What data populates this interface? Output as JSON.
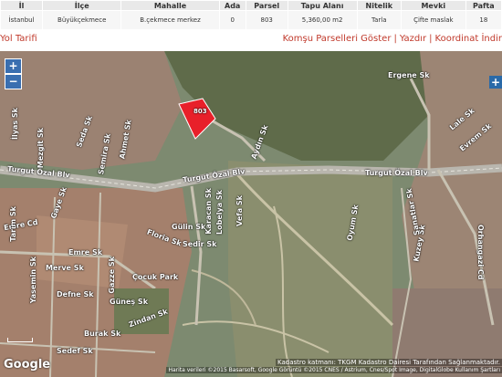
{
  "table": {
    "headers": [
      "İl",
      "İlçe",
      "Mahalle",
      "Ada",
      "Parsel",
      "Tapu Alanı",
      "Nitelik",
      "Mevki",
      "Pafta"
    ],
    "row": [
      "İstanbul",
      "Büyükçekmece",
      "B.çekmece merkez",
      "0",
      "803",
      "5,360,00 m2",
      "Tarla",
      "Çifte maslak",
      "18"
    ]
  },
  "links": {
    "route": "Yol Tarifi",
    "neighbors": "Komşu Parselleri Göster",
    "print": "Yazdır",
    "coords": "Koordinat İndir",
    "separator": "|"
  },
  "map": {
    "zoom_in": "+",
    "zoom_out": "−",
    "parcel_label": "803",
    "plus_marker": "+",
    "google": "Google",
    "kadastro": "Kadastro katmanı: TKGM Kadastro Dairesi Tarafından Sağlanmaktadır.",
    "attribution": "Harita verileri ©2015 Basarsoft, Google Görüntü ©2015 CNES / Astrium, Cnes/Spot Image, DigitalGlobe   Kullanım Şartları",
    "streets": {
      "turgut1": "Turgut Özal Blv",
      "turgut2": "Turgut Özal Blv",
      "turgut3": "Turgut Özal Blv",
      "ergene": "Ergene Sk",
      "aydin": "Aydın Sk",
      "emre_cd": "Emre Cd",
      "emre_sk": "Emre Sk",
      "merve": "Merve Sk",
      "defne": "Defne Sk",
      "gunes": "Güneş Sk",
      "zindan": "Zindan Sk",
      "burak": "Burak Sk",
      "sedef": "Sedef Sk",
      "cocuk": "Çocuk Park",
      "flora": "Floria Sk",
      "gulin": "Gülin Sk",
      "sedir": "Sedir Sk",
      "vefa": "Vefa Sk",
      "oyum": "Oyum Sk",
      "kuzey": "Kuzey Sk",
      "sanat": "Şanatlar Sk",
      "lale": "Lale Sk",
      "evrem": "Evrem Sk",
      "orhangazi": "Orhangazi Cd",
      "gaye": "Gaye Sk",
      "seda": "Seda Sk",
      "mezgit": "Mezgit Sk",
      "semira": "Semira Sk",
      "ilyas": "İlyas Sk",
      "tarim": "Tarım Sk",
      "yasemin": "Yasemin Sk",
      "gazze": "Gazze Sk",
      "lobelya": "Lobelya Sk",
      "karacan": "Karacan Sk",
      "ahmet": "Ahmet Sk"
    }
  },
  "colors": {
    "link": "#c0392b",
    "header_bg": "#e9e9e9",
    "parcel_fill": "#e8202a",
    "zoom_bg": "#3a6fb0"
  }
}
